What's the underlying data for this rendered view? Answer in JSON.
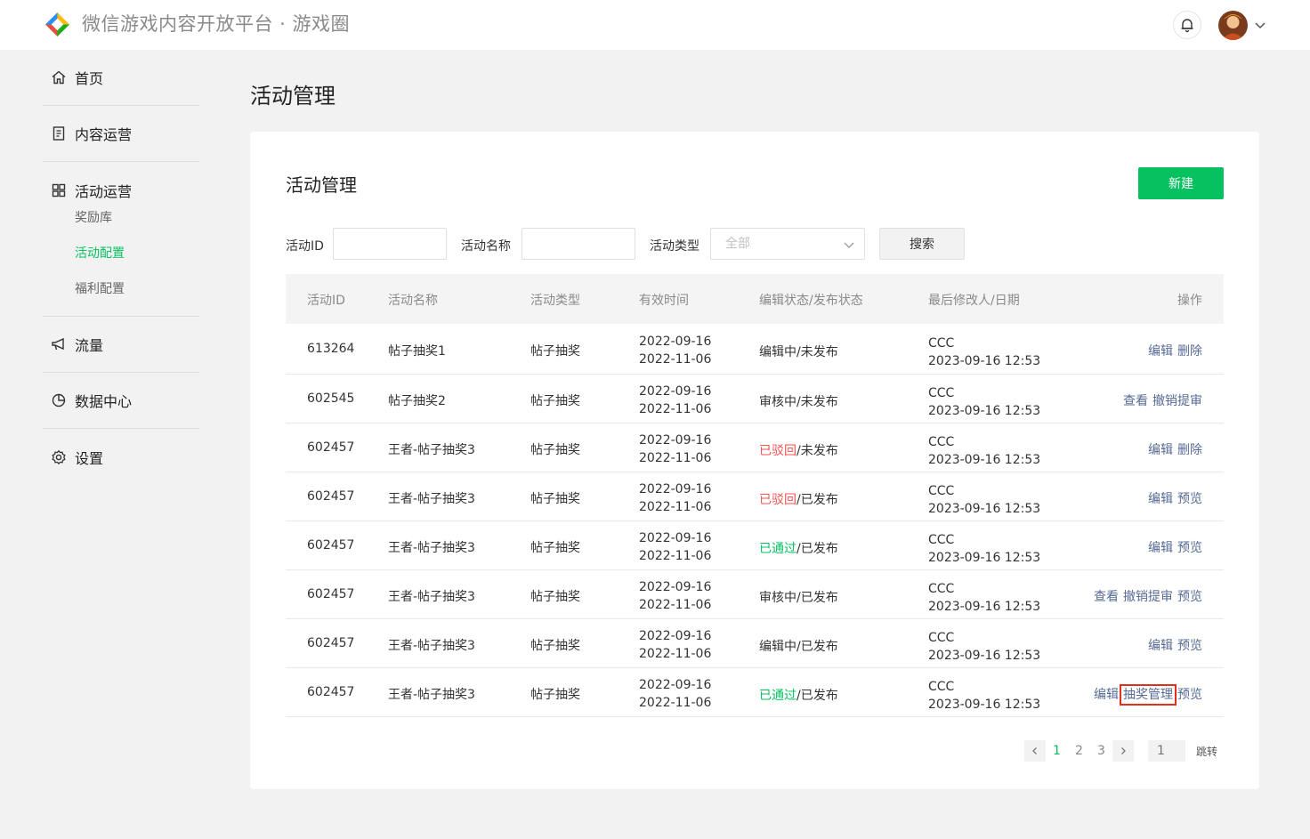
{
  "header": {
    "title": "微信游戏内容开放平台 · 游戏圈"
  },
  "sidebar": {
    "items": [
      {
        "label": "首页",
        "icon": "home-icon"
      },
      {
        "label": "内容运营",
        "icon": "document-icon"
      },
      {
        "label": "活动运营",
        "icon": "grid-icon"
      },
      {
        "label": "流量",
        "icon": "megaphone-icon"
      },
      {
        "label": "数据中心",
        "icon": "pie-chart-icon"
      },
      {
        "label": "设置",
        "icon": "gear-icon"
      }
    ],
    "sub_items": [
      {
        "label": "奖励库",
        "active": false
      },
      {
        "label": "活动配置",
        "active": true
      },
      {
        "label": "福利配置",
        "active": false
      }
    ]
  },
  "page": {
    "title": "活动管理"
  },
  "card": {
    "title": "活动管理",
    "new_button": "新建"
  },
  "filters": {
    "id_label": "活动ID",
    "id_value": "",
    "name_label": "活动名称",
    "name_value": "",
    "type_label": "活动类型",
    "type_selected": "全部",
    "search_button": "搜索"
  },
  "table": {
    "headers": [
      "活动ID",
      "活动名称",
      "活动类型",
      "有效时间",
      "编辑状态/发布状态",
      "最后修改人/日期",
      "操作"
    ],
    "rows": [
      {
        "id": "613264",
        "name": "帖子抽奖1",
        "type": "帖子抽奖",
        "start": "2022-09-16",
        "end": "2022-11-06",
        "edit_state": "编辑中",
        "pub_state": "/未发布",
        "edit_color": "normal",
        "modifier": "CCC",
        "modified": "2023-09-16 12:53",
        "ops": [
          "编辑",
          "删除"
        ]
      },
      {
        "id": "602545",
        "name": "帖子抽奖2",
        "type": "帖子抽奖",
        "start": "2022-09-16",
        "end": "2022-11-06",
        "edit_state": "审核中",
        "pub_state": "/未发布",
        "edit_color": "normal",
        "modifier": "CCC",
        "modified": "2023-09-16 12:53",
        "ops": [
          "查看",
          "撤销提审"
        ]
      },
      {
        "id": "602457",
        "name": "王者-帖子抽奖3",
        "type": "帖子抽奖",
        "start": "2022-09-16",
        "end": "2022-11-06",
        "edit_state": "已驳回",
        "pub_state": "/未发布",
        "edit_color": "red",
        "modifier": "CCC",
        "modified": "2023-09-16 12:53",
        "ops": [
          "编辑",
          "删除"
        ]
      },
      {
        "id": "602457",
        "name": "王者-帖子抽奖3",
        "type": "帖子抽奖",
        "start": "2022-09-16",
        "end": "2022-11-06",
        "edit_state": "已驳回",
        "pub_state": "/已发布",
        "edit_color": "red",
        "modifier": "CCC",
        "modified": "2023-09-16 12:53",
        "ops": [
          "编辑",
          "预览"
        ]
      },
      {
        "id": "602457",
        "name": "王者-帖子抽奖3",
        "type": "帖子抽奖",
        "start": "2022-09-16",
        "end": "2022-11-06",
        "edit_state": "已通过",
        "pub_state": "/已发布",
        "edit_color": "green",
        "modifier": "CCC",
        "modified": "2023-09-16 12:53",
        "ops": [
          "编辑",
          "预览"
        ]
      },
      {
        "id": "602457",
        "name": "王者-帖子抽奖3",
        "type": "帖子抽奖",
        "start": "2022-09-16",
        "end": "2022-11-06",
        "edit_state": "审核中",
        "pub_state": "/已发布",
        "edit_color": "normal",
        "modifier": "CCC",
        "modified": "2023-09-16 12:53",
        "ops": [
          "查看",
          "撤销提审",
          "预览"
        ]
      },
      {
        "id": "602457",
        "name": "王者-帖子抽奖3",
        "type": "帖子抽奖",
        "start": "2022-09-16",
        "end": "2022-11-06",
        "edit_state": "编辑中",
        "pub_state": "/已发布",
        "edit_color": "normal",
        "modifier": "CCC",
        "modified": "2023-09-16 12:53",
        "ops": [
          "编辑",
          "预览"
        ]
      },
      {
        "id": "602457",
        "name": "王者-帖子抽奖3",
        "type": "帖子抽奖",
        "start": "2022-09-16",
        "end": "2022-11-06",
        "edit_state": "已通过",
        "pub_state": "/已发布",
        "edit_color": "green",
        "modifier": "CCC",
        "modified": "2023-09-16 12:53",
        "ops": [
          "编辑",
          "抽奖管理",
          "预览"
        ],
        "highlight_op": "抽奖管理"
      }
    ]
  },
  "pagination": {
    "pages": [
      "1",
      "2",
      "3"
    ],
    "current": "1",
    "jump_placeholder": "1",
    "jump_label": "跳转"
  },
  "colors": {
    "accent": "#07c160",
    "link": "#576b95",
    "danger": "#fa5151",
    "highlight_box": "#e0301e"
  }
}
